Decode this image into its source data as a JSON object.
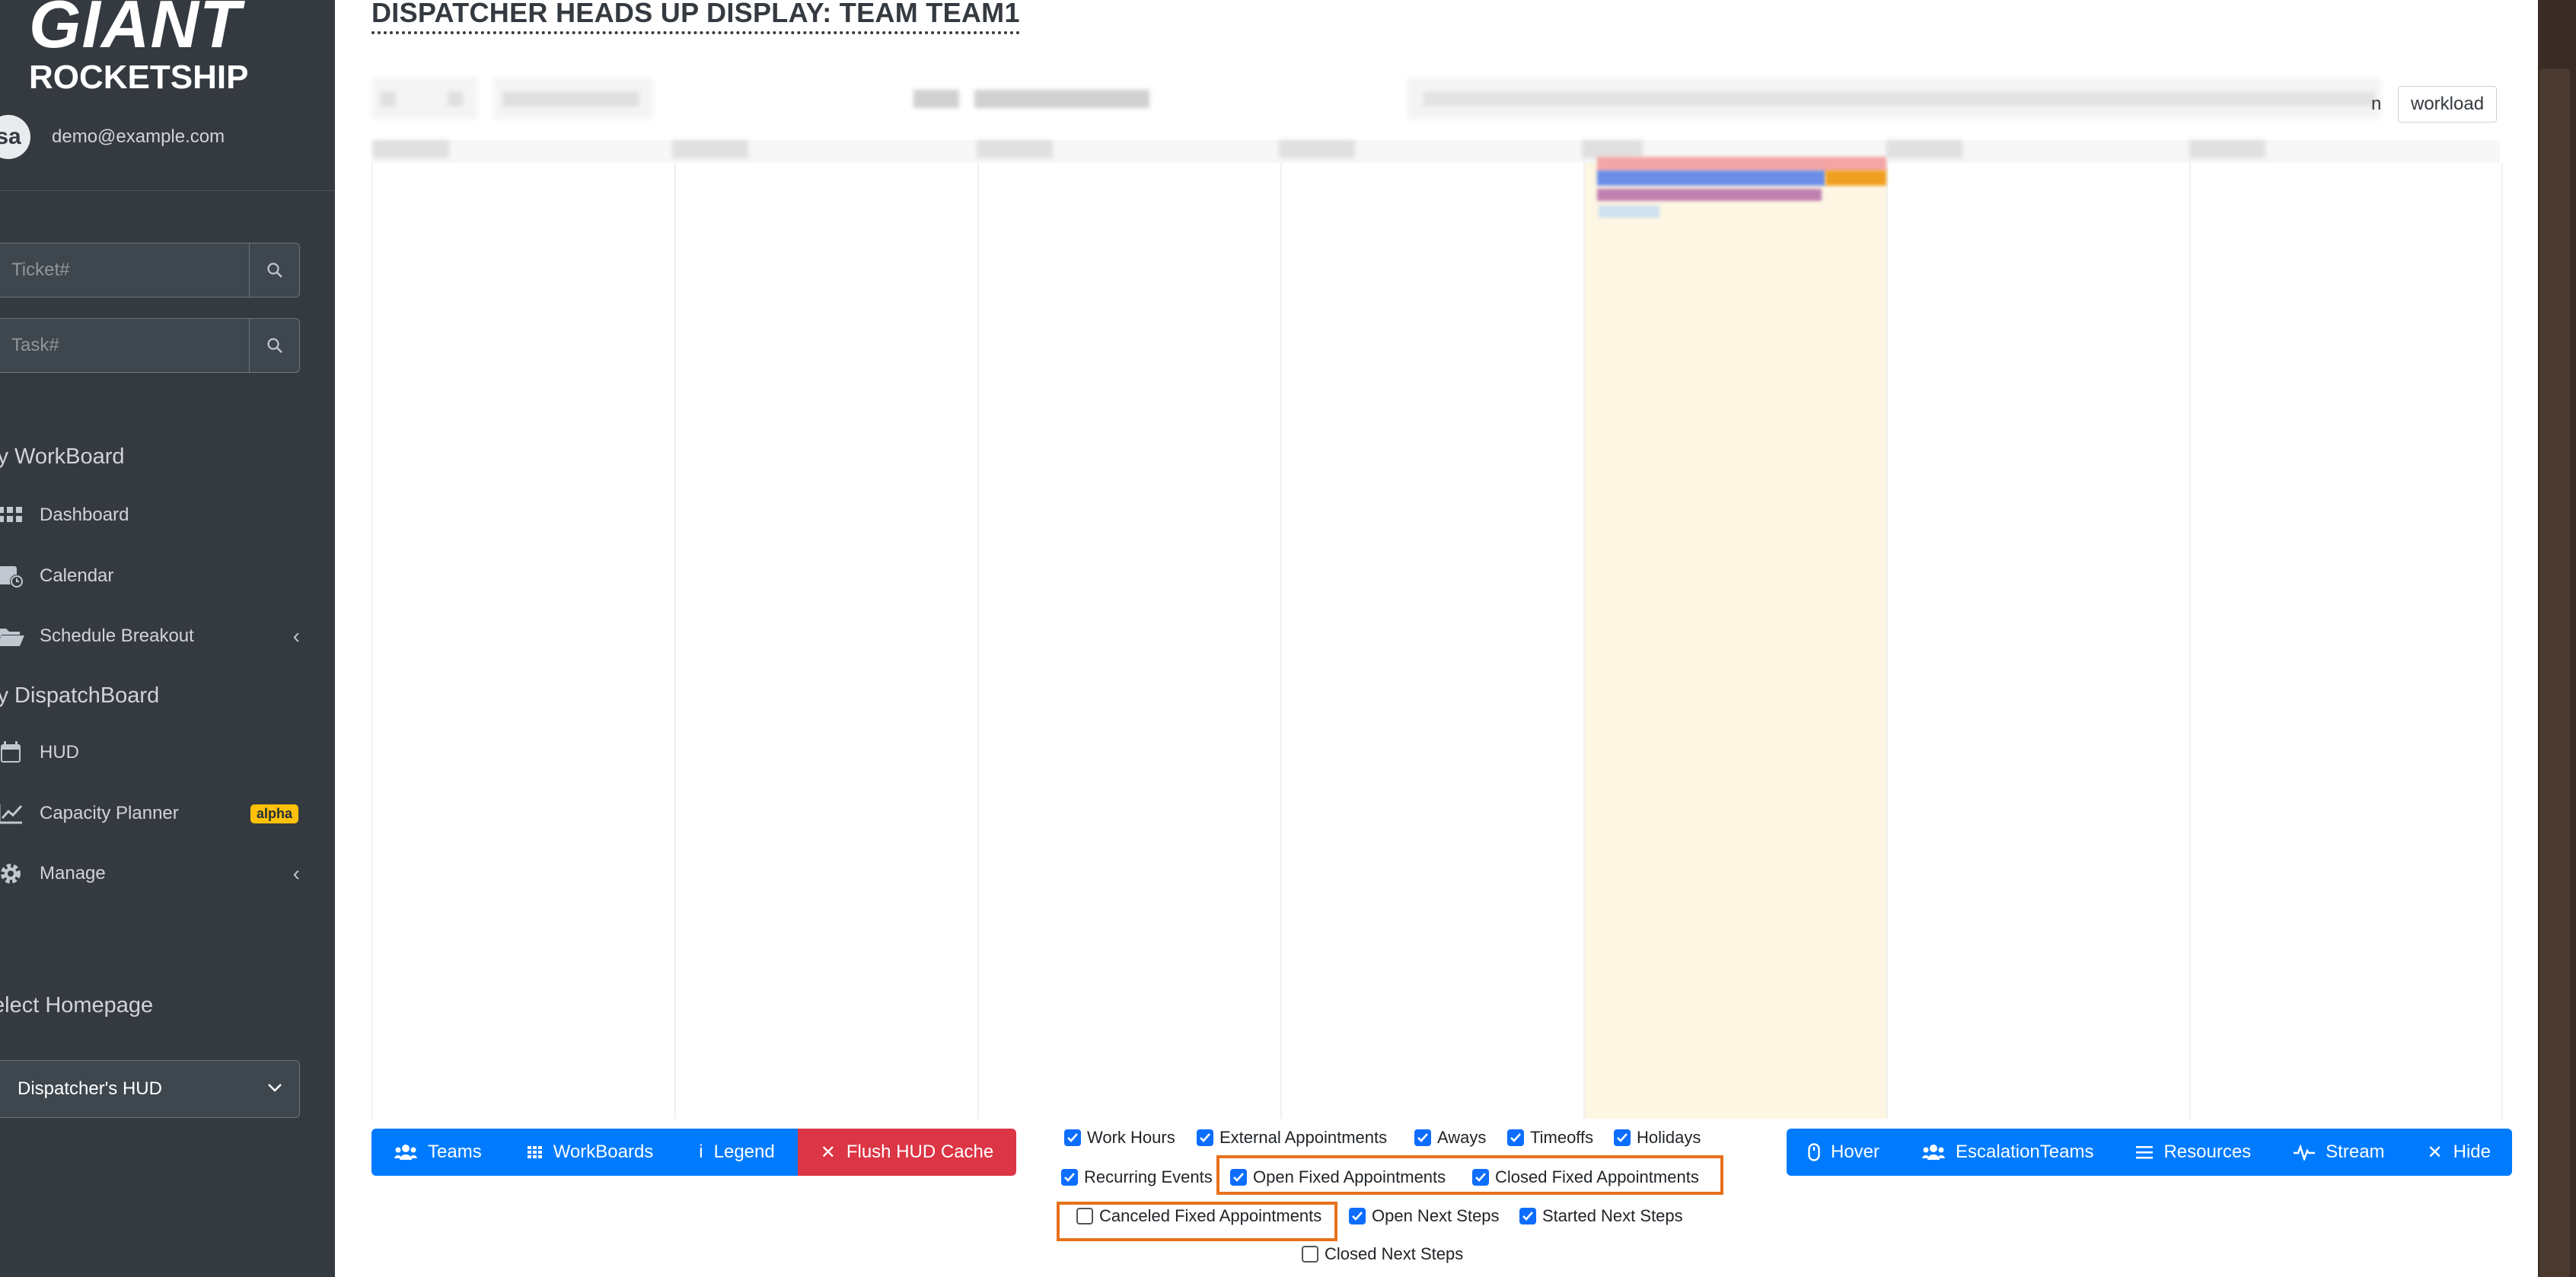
{
  "sidebar": {
    "brand_line1": "GIANT",
    "brand_line2": "ROCKETSHIP",
    "avatar_initials": "sa",
    "user_email": "demo@example.com",
    "ticket_placeholder": "Ticket#",
    "task_placeholder": "Task#",
    "section_workboard": "ly WorkBoard",
    "items_workboard": [
      {
        "label": "Dashboard",
        "icon": "dashboard-icon"
      },
      {
        "label": "Calendar",
        "icon": "calendar-icon"
      },
      {
        "label": "Schedule Breakout",
        "icon": "folder-open-icon"
      }
    ],
    "section_dispatchboard": "ly DispatchBoard",
    "items_dispatch": [
      {
        "label": "HUD",
        "icon": "calendar-icon"
      },
      {
        "label": "Capacity Planner",
        "icon": "chart-line-icon",
        "badge": "alpha"
      },
      {
        "label": "Manage",
        "icon": "gear-icon"
      }
    ],
    "homepage_label": "elect Homepage",
    "homepage_value": "Dispatcher's HUD"
  },
  "main": {
    "title": "DISPATCHER HEADS UP DISPLAY: TEAM TEAM1",
    "workload_label": "workload",
    "workload_prev_fragment": "n"
  },
  "left_buttons": [
    {
      "label": "Teams",
      "icon": "users-icon"
    },
    {
      "label": "WorkBoards",
      "icon": "grid-icon"
    },
    {
      "label": "Legend",
      "icon": "info-icon"
    },
    {
      "label": "Flush HUD Cache",
      "icon": "close-icon",
      "style": "danger"
    }
  ],
  "right_buttons": [
    {
      "label": "Hover",
      "icon": "mouse-icon"
    },
    {
      "label": "EscalationTeams",
      "icon": "users-icon"
    },
    {
      "label": "Resources",
      "icon": "list-icon"
    },
    {
      "label": "Stream",
      "icon": "pulse-icon"
    },
    {
      "label": "Hide",
      "icon": "close-icon"
    }
  ],
  "filters": [
    {
      "label": "Work Hours",
      "checked": true
    },
    {
      "label": "External Appointments",
      "checked": true
    },
    {
      "label": "Aways",
      "checked": true
    },
    {
      "label": "Timeoffs",
      "checked": true
    },
    {
      "label": "Holidays",
      "checked": true
    },
    {
      "label": "Recurring Events",
      "checked": true
    },
    {
      "label": "Open Fixed Appointments",
      "checked": true
    },
    {
      "label": "Closed Fixed Appointments",
      "checked": true
    },
    {
      "label": "Canceled Fixed Appointments",
      "checked": false
    },
    {
      "label": "Open Next Steps",
      "checked": true
    },
    {
      "label": "Started Next Steps",
      "checked": true
    },
    {
      "label": "Closed Next Steps",
      "checked": false
    }
  ],
  "colors": {
    "sidebar_bg": "#343a40",
    "primary": "#007bff",
    "danger": "#dc3545",
    "highlight": "#e8711c",
    "today_column": "#fdf6e3",
    "badge": "#ffc107"
  }
}
